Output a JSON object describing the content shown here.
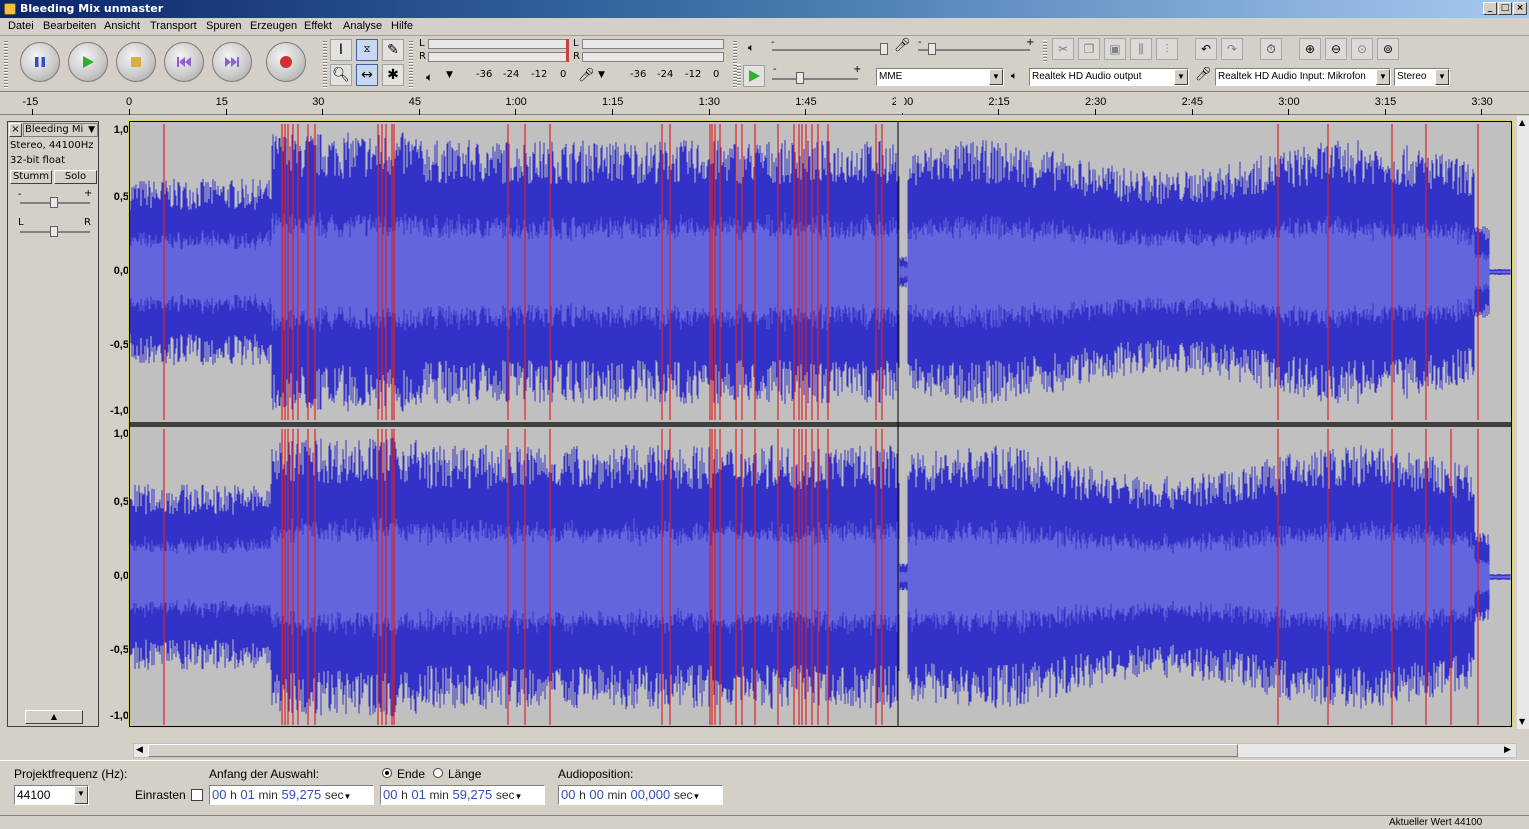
{
  "window": {
    "title": "Bleeding Mix unmaster",
    "min": "_",
    "restore": "□",
    "close": "×"
  },
  "menu": [
    "Datei",
    "Bearbeiten",
    "Ansicht",
    "Transport",
    "Spuren",
    "Erzeugen",
    "Effekt",
    "Analyse",
    "Hilfe"
  ],
  "transport": {
    "pause_icon": "pause-icon",
    "play_icon": "play-icon",
    "stop_icon": "stop-icon",
    "skip_start_icon": "skip-start-icon",
    "skip_end_icon": "skip-end-icon",
    "record_icon": "record-icon"
  },
  "meters": {
    "L": "L",
    "R": "R",
    "play_scale": [
      "-36",
      "-24",
      "-12",
      "0"
    ],
    "rec_scale": [
      "-36",
      "-24",
      "-12",
      "0"
    ]
  },
  "mixer": {
    "minus": "-",
    "plus": "+"
  },
  "devices": {
    "host": "MME",
    "output": "Realtek HD Audio output",
    "input": "Realtek HD Audio Input: Mikrofon",
    "channels": "Stereo"
  },
  "ruler": {
    "ticks": [
      "-15",
      "0",
      "15",
      "30",
      "45",
      "1:00",
      "1:15",
      "1:30",
      "1:45",
      "2:00",
      "2:15",
      "2:30",
      "2:45",
      "3:00",
      "3:15",
      "3:30"
    ]
  },
  "track": {
    "name": "Bleeding Mi",
    "close": "×",
    "format1": "Stereo, 44100Hz",
    "format2": "32-bit float",
    "mute": "Stumm",
    "solo": "Solo",
    "gain_minus": "-",
    "gain_plus": "+",
    "pan_left": "L",
    "pan_right": "R",
    "collapse": "▲",
    "yaxis": [
      "1,0",
      "0,5",
      "0,0",
      "-0,5",
      "-1,0"
    ]
  },
  "colors": {
    "wave_dark": "#3232c8",
    "wave_light": "#6464dc",
    "clip": "#e02020",
    "bg": "#c0c0c0"
  },
  "selection": {
    "rate_label": "Projektfrequenz (Hz):",
    "rate_value": "44100",
    "snap_label": "Einrasten",
    "start_label": "Anfang der Auswahl:",
    "end_option": "Ende",
    "length_option": "Länge",
    "audiopos_label": "Audioposition:",
    "start": {
      "h": "00",
      "hu": "h",
      "m": "01",
      "mu": "min",
      "s": "59,275",
      "su": "sec"
    },
    "end": {
      "h": "00",
      "hu": "h",
      "m": "01",
      "mu": "min",
      "s": "59,275",
      "su": "sec"
    },
    "pos": {
      "h": "00",
      "hu": "h",
      "m": "00",
      "mu": "min",
      "s": "00,000",
      "su": "sec"
    }
  },
  "status": {
    "text": "Aktueller Wert 44100"
  }
}
